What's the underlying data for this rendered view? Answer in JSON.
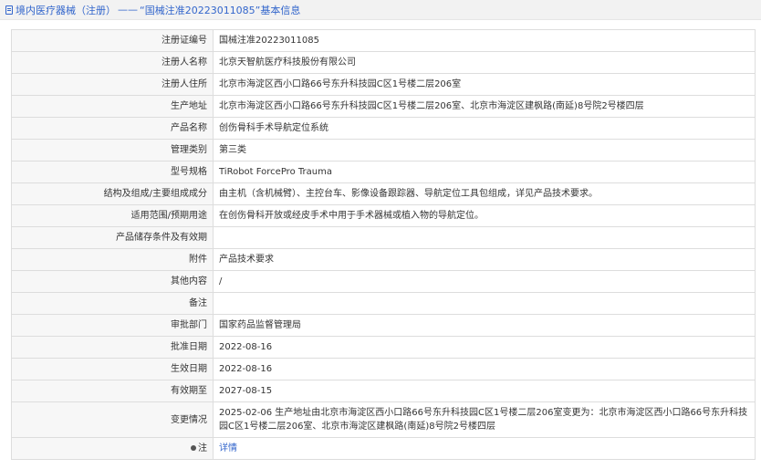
{
  "header": {
    "part1": "境内医疗器械（注册）",
    "separator": "——",
    "part2": "“国械注准20223011085”",
    "part3": "基本信息"
  },
  "rows": [
    {
      "label": "注册证编号",
      "value": "国械注准20223011085"
    },
    {
      "label": "注册人名称",
      "value": "北京天智航医疗科技股份有限公司"
    },
    {
      "label": "注册人住所",
      "value": "北京市海淀区西小口路66号东升科技园C区1号楼二层206室"
    },
    {
      "label": "生产地址",
      "value": "北京市海淀区西小口路66号东升科技园C区1号楼二层206室、北京市海淀区建枫路(南延)8号院2号楼四层"
    },
    {
      "label": "产品名称",
      "value": "创伤骨科手术导航定位系统"
    },
    {
      "label": "管理类别",
      "value": "第三类"
    },
    {
      "label": "型号规格",
      "value": "TiRobot ForcePro Trauma"
    },
    {
      "label": "结构及组成/主要组成成分",
      "value": "由主机（含机械臂）、主控台车、影像设备跟踪器、导航定位工具包组成，详见产品技术要求。"
    },
    {
      "label": "适用范围/预期用途",
      "value": "在创伤骨科开放或经皮手术中用于手术器械或植入物的导航定位。"
    },
    {
      "label": "产品储存条件及有效期",
      "value": ""
    },
    {
      "label": "附件",
      "value": "产品技术要求"
    },
    {
      "label": "其他内容",
      "value": "/"
    },
    {
      "label": "备注",
      "value": ""
    },
    {
      "label": "审批部门",
      "value": "国家药品监督管理局"
    },
    {
      "label": "批准日期",
      "value": "2022-08-16"
    },
    {
      "label": "生效日期",
      "value": "2022-08-16"
    },
    {
      "label": "有效期至",
      "value": "2027-08-15"
    },
    {
      "label": "变更情况",
      "value": "2025-02-06 生产地址由北京市海淀区西小口路66号东升科技园C区1号楼二层206室变更为：北京市海淀区西小口路66号东升科技园C区1号楼二层206室、北京市海淀区建枫路(南延)8号院2号楼四层"
    }
  ],
  "note_row": {
    "label": "注",
    "link": "详情"
  }
}
